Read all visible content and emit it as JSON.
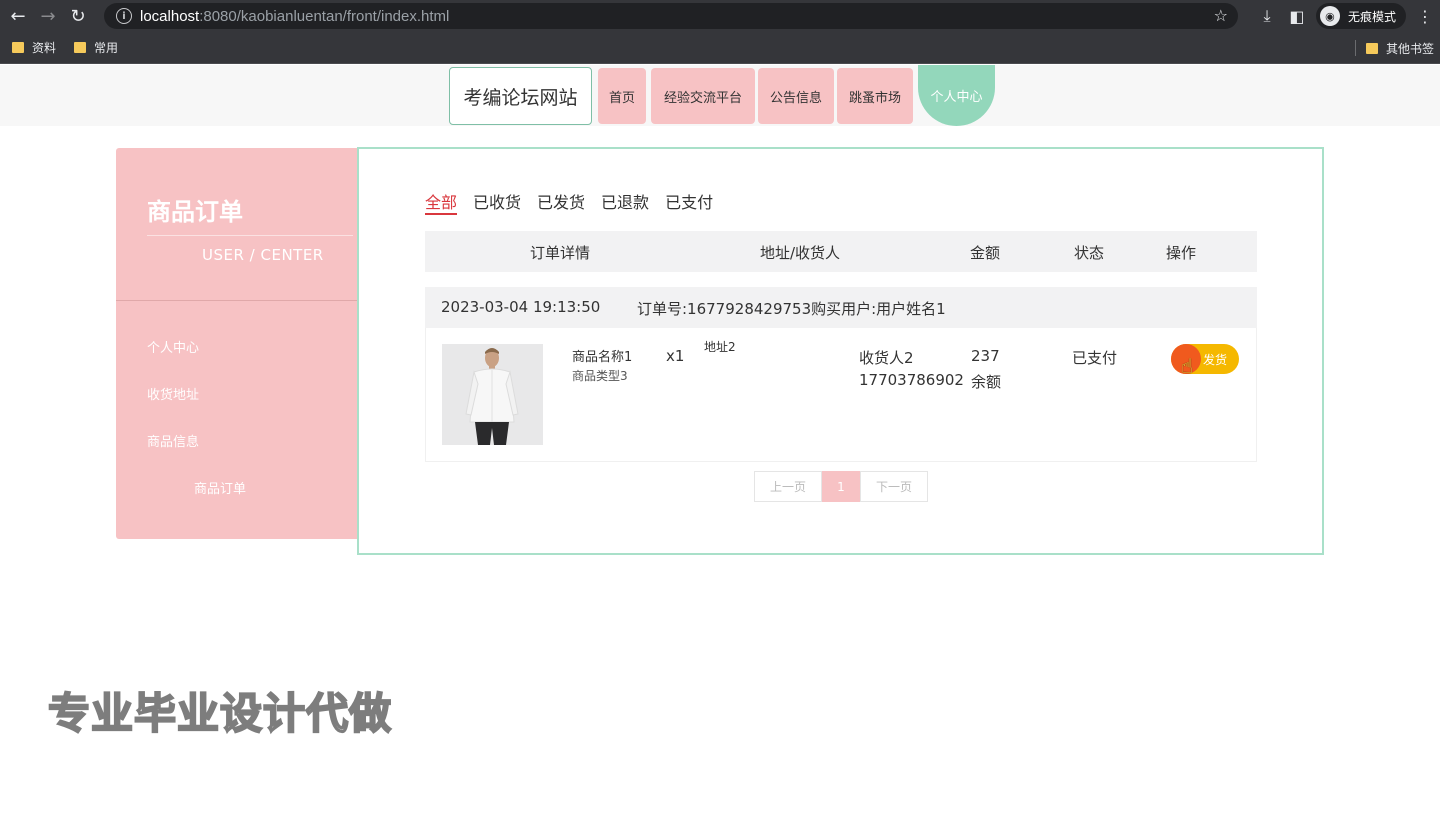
{
  "browser": {
    "url_host": "localhost",
    "url_port_path": ":8080/kaobianluentan/front/index.html",
    "incognito_label": "无痕模式",
    "bookmarks": [
      "资料",
      "常用"
    ],
    "other_bookmarks": "其他书签"
  },
  "header": {
    "brand": "考编论坛网站",
    "nav": [
      "首页",
      "经验交流平台",
      "公告信息",
      "跳蚤市场",
      "个人中心"
    ]
  },
  "sidebar": {
    "title": "商品订单",
    "subtitle": "USER / CENTER",
    "items": [
      "个人中心",
      "收货地址",
      "商品信息",
      "商品订单"
    ]
  },
  "tabs": [
    "全部",
    "已收货",
    "已发货",
    "已退款",
    "已支付"
  ],
  "table_headers": [
    "订单详情",
    "地址/收货人",
    "金额",
    "状态",
    "操作"
  ],
  "order": {
    "datetime": "2023-03-04 19:13:50",
    "info": "订单号:1677928429753购买用户:用户姓名1",
    "product_name": "商品名称1",
    "product_type": "商品类型3",
    "quantity": "x1",
    "address": "地址2",
    "receiver": "收货人2",
    "phone": "17703786902",
    "amount": "237",
    "pay_method": "余额",
    "status": "已支付",
    "action": "发货"
  },
  "pager": {
    "prev": "上一页",
    "current": "1",
    "next": "下一页"
  },
  "watermark": "专业毕业设计代做"
}
